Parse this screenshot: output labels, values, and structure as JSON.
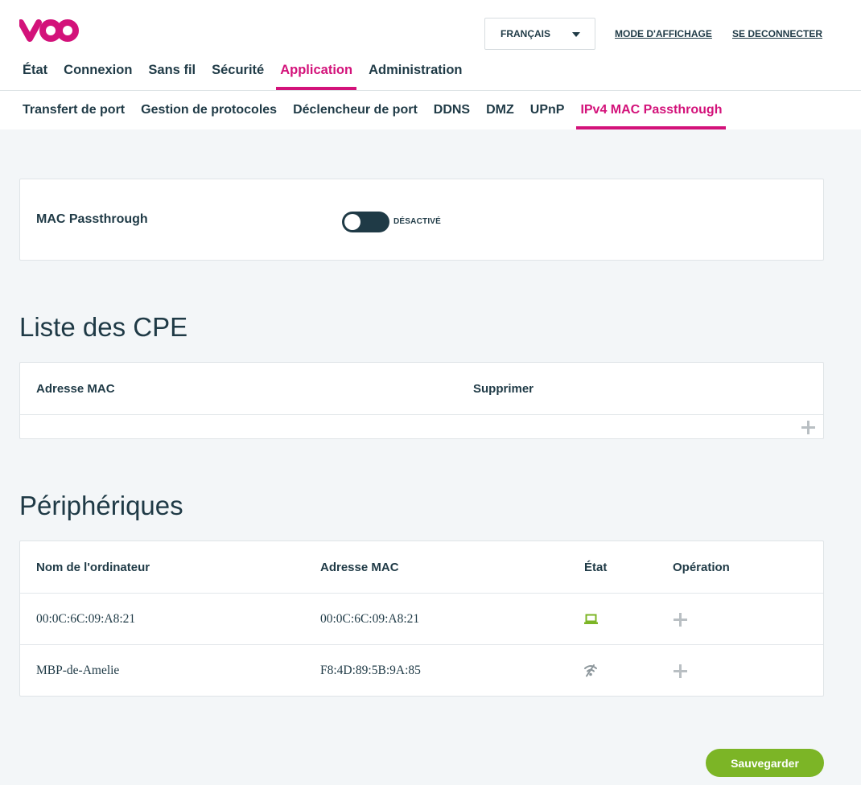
{
  "header": {
    "language_selected": "FRANÇAIS",
    "display_mode": "MODE D'AFFICHAGE",
    "logout": "SE DECONNECTER"
  },
  "main_nav": [
    "État",
    "Connexion",
    "Sans fil",
    "Sécurité",
    "Application",
    "Administration"
  ],
  "sub_nav": [
    "Transfert de port",
    "Gestion de protocoles",
    "Déclencheur de port",
    "DDNS",
    "DMZ",
    "UPnP",
    "IPv4 MAC Passthrough"
  ],
  "mac_passthrough": {
    "label": "MAC Passthrough",
    "state": "DÉSACTIVÉ"
  },
  "cpe_list": {
    "title": "Liste des CPE",
    "columns": [
      "Adresse MAC",
      "Supprimer"
    ]
  },
  "devices": {
    "title": "Périphériques",
    "columns": [
      "Nom de l'ordinateur",
      "Adresse MAC",
      "État",
      "Opération"
    ],
    "rows": [
      {
        "name": "00:0C:6C:09:A8:21",
        "mac": "00:0C:6C:09:A8:21",
        "status_icon": "laptop-icon"
      },
      {
        "name": "MBP-de-Amelie",
        "mac": "F8:4D:89:5B:9A:85",
        "status_icon": "wifi-off-icon"
      }
    ]
  },
  "save_label": "Sauvegarder",
  "colors": {
    "brand": "#d3127a",
    "dark": "#1f3a46",
    "green": "#7cb526"
  }
}
